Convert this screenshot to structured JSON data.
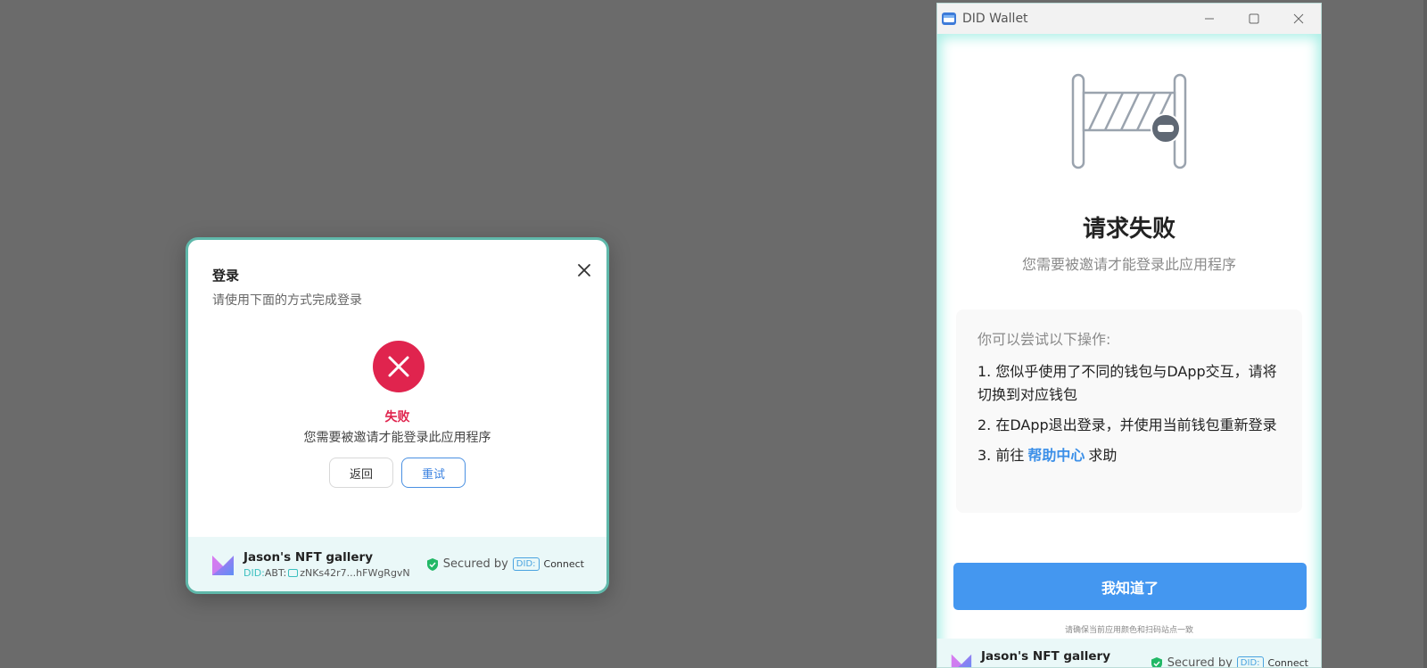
{
  "login_dialog": {
    "title": "登录",
    "subtitle": "请使用下面的方式完成登录",
    "status_title": "失败",
    "status_message": "您需要被邀请才能登录此应用程序",
    "back_label": "返回",
    "retry_label": "重试",
    "footer": {
      "app_name": "Jason's NFT gallery",
      "did_prefix": "DID:",
      "did_type": "ABT:",
      "did_value": "zNKs42r7...hFWgRgvN",
      "secured_label": "Secured by",
      "did_badge": "DID:",
      "connect_label": "Connect"
    }
  },
  "wallet_window": {
    "title": "DID Wallet",
    "error_heading": "请求失败",
    "error_message": "您需要被邀请才能登录此应用程序",
    "tips_title": "你可以尝试以下操作:",
    "tips": [
      "1. 您似乎使用了不同的钱包与DApp交互，请将切换到对应钱包",
      "2. 在DApp退出登录，并使用当前钱包重新登录"
    ],
    "tip3_prefix": "3. 前往",
    "tip3_link": "帮助中心",
    "tip3_suffix": "求助",
    "confirm_label": "我知道了",
    "note": "请确保当前应用颜色和扫码站点一致",
    "footer": {
      "app_name": "Jason's NFT gallery",
      "secured_label": "Secured by",
      "did_badge": "DID:",
      "connect_label": "Connect"
    }
  },
  "colors": {
    "error_red": "#e0244e",
    "primary_blue": "#4497f0",
    "teal_border": "#5fb8aa",
    "backdrop": "#6b6b6b"
  }
}
